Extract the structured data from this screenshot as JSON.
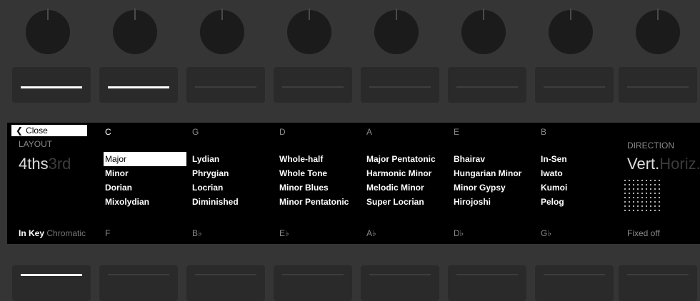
{
  "display": {
    "close_label": "Close",
    "layout": {
      "label": "LAYOUT",
      "active": "4ths",
      "inactive": "3rd"
    },
    "roots_top": [
      "C",
      "G",
      "D",
      "A",
      "E",
      "B"
    ],
    "roots_bottom": [
      "F",
      "B♭",
      "E♭",
      "A♭",
      "D♭",
      "G♭"
    ],
    "scale_columns": [
      [
        "Major",
        "Minor",
        "Dorian",
        "Mixolydian"
      ],
      [
        "Lydian",
        "Phrygian",
        "Locrian",
        "Diminished"
      ],
      [
        "Whole-half",
        "Whole Tone",
        "Minor Blues",
        "Minor Pentatonic"
      ],
      [
        "Major Pentatonic",
        "Harmonic Minor",
        "Melodic Minor",
        "Super Locrian"
      ],
      [
        "Bhairav",
        "Hungarian Minor",
        "Minor Gypsy",
        "Hirojoshi"
      ],
      [
        "In-Sen",
        "Iwato",
        "Kumoi",
        "Pelog"
      ]
    ],
    "selected_scale": "Major",
    "selected_root": "C",
    "key_mode": {
      "active": "In Key",
      "inactive": "Chromatic"
    },
    "direction": {
      "label": "DIRECTION",
      "active": "Vert.",
      "inactive": "Horiz."
    },
    "fixed_label": "Fixed off"
  },
  "top_buttons_lit": [
    true,
    true,
    false,
    false,
    false,
    false,
    false,
    false
  ],
  "bottom_buttons_lit": [
    true,
    false,
    false,
    false,
    false,
    false,
    false,
    false
  ]
}
